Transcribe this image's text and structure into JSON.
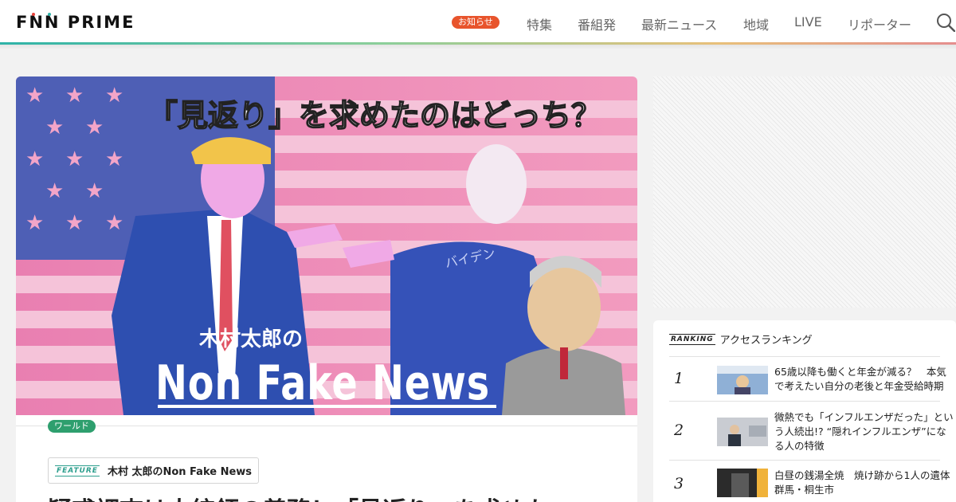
{
  "header": {
    "logo_text": "FNN PRIME",
    "notice_badge": "お知らせ",
    "nav": [
      {
        "label": "特集"
      },
      {
        "label": "番組発"
      },
      {
        "label": "最新ニュース"
      },
      {
        "label": "地域"
      },
      {
        "label": "LIVE"
      },
      {
        "label": "リポーター"
      }
    ],
    "search_icon": "search-icon"
  },
  "article": {
    "hero": {
      "headline_top": "「見返り」を求めたのはどっち？",
      "series_owner": "木村太郎の",
      "series_name": "Non Fake News",
      "biden_label": "バイデン"
    },
    "category": "ワールド",
    "feature_tag": "FEATURE",
    "feature_name": "木村 太郎のNon Fake News",
    "title": "疑惑調査は大統領の義務！「見返り」を求めた"
  },
  "ranking": {
    "tag": "RANKING",
    "title": "アクセスランキング",
    "items": [
      {
        "rank": "1",
        "text": "65歳以降も働くと年金が減る？　本気で考えたい自分の老後と年金受給時期"
      },
      {
        "rank": "2",
        "text": "微熱でも「インフルエンザだった」という人続出!? “隠れインフルエンザ”になる人の特徴"
      },
      {
        "rank": "3",
        "text": "白昼の銭湯全焼　焼け跡から1人の遺体　群馬・桐生市"
      }
    ]
  },
  "colors": {
    "header_gradient": [
      "#2fb3a8",
      "#e8c07a",
      "#e58e8e"
    ],
    "notice_badge": "#e8542c",
    "category_badge": "#2e9f6e",
    "feature_accent": "#2e9f8e"
  }
}
